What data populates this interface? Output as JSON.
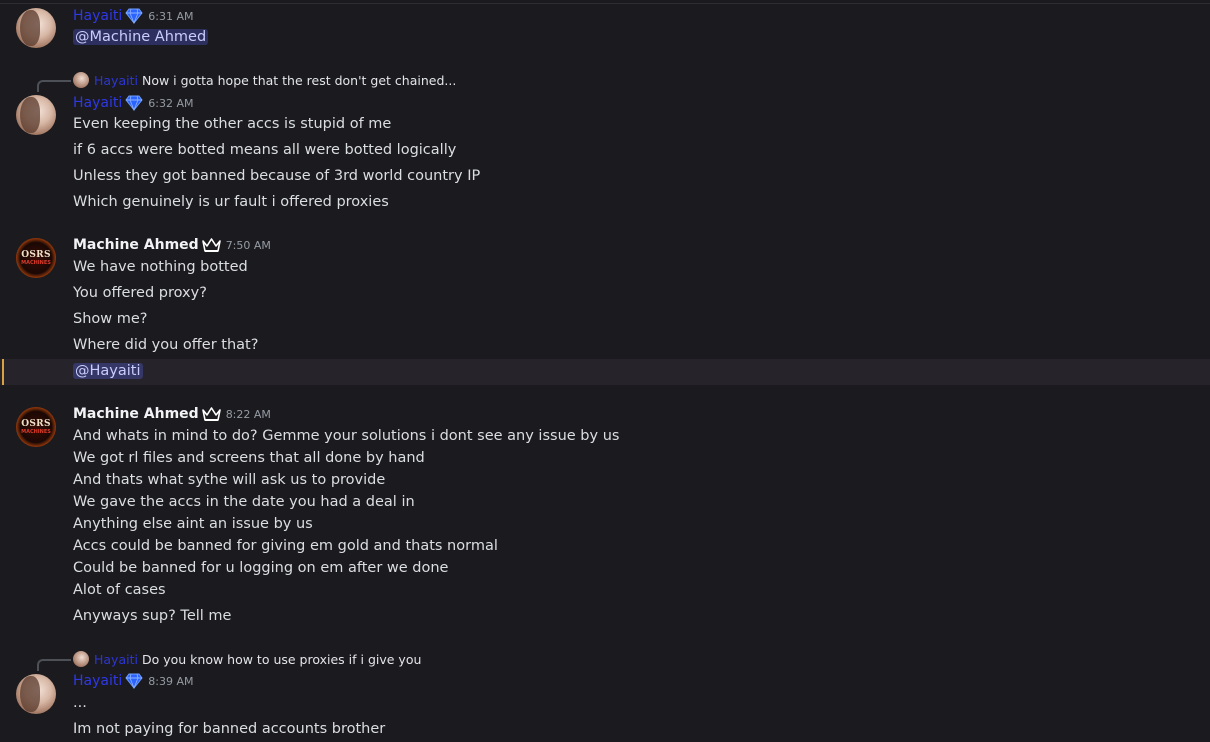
{
  "messages": [
    {
      "author": "Hayaiti",
      "time": "6:31 AM",
      "lines": [],
      "mention": "@Machine Ahmed"
    },
    {
      "reply": {
        "author": "Hayaiti",
        "text": "Now i gotta hope that the rest don't get chained..."
      },
      "author": "Hayaiti",
      "time": "6:32 AM",
      "lines": [
        "Even keeping the other accs is stupid of me",
        "if 6 accs were botted means all were botted logically",
        "Unless they got banned because of 3rd world country IP",
        "Which genuinely is ur fault i offered proxies"
      ]
    },
    {
      "author": "Machine Ahmed",
      "time": "7:50 AM",
      "avatar_text": "OSRS",
      "avatar_sub": "MACHINES",
      "lines": [
        "We have nothing botted",
        "You offered proxy?",
        "Show me?",
        "Where did you offer that?"
      ],
      "mention": "@Hayaiti"
    },
    {
      "author": "Machine Ahmed",
      "time": "8:22 AM",
      "avatar_text": "OSRS",
      "avatar_sub": "MACHINES",
      "lines": [
        "And whats in mind to do? Gemme your solutions i dont see any issue by us",
        "We got rl files and screens that all done by hand",
        "And thats what sythe will ask us to provide",
        "We gave the accs in the date you had a deal in",
        "Anything else aint an issue by us",
        "Accs could be banned for giving em gold and thats normal",
        "Could be banned for u logging on em after we done",
        "Alot of cases",
        "Anyways sup? Tell me"
      ]
    },
    {
      "reply": {
        "author": "Hayaiti",
        "text": "Do you know how to use proxies if i give you"
      },
      "author": "Hayaiti",
      "time": "8:39 AM",
      "lines": [
        "...",
        "Im not paying for banned accounts brother"
      ]
    }
  ],
  "colors": {
    "background": "#1b1b1f",
    "hayaiti_name": "#2e38e6",
    "mention_bg": "#3a3f76",
    "highlight_bar": "#d9a044"
  },
  "icons": {
    "hayaiti_badge": "diamond-icon",
    "machine_badge": "crown-icon"
  }
}
